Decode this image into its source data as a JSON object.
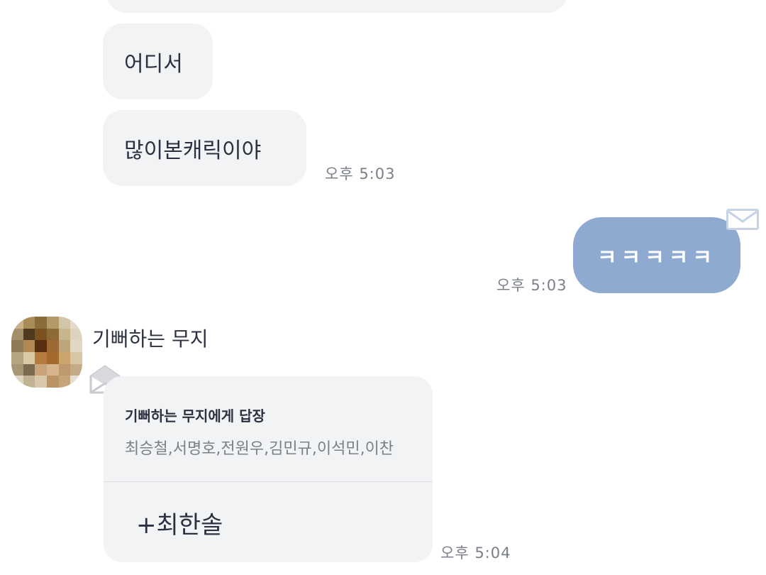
{
  "messages": {
    "top_partial": "",
    "m1": "어디서",
    "m2": "많이본캐릭이야",
    "m2_time": "오후 5:03",
    "m3": "ㅋㅋㅋㅋㅋ",
    "m3_time": "오후 5:03"
  },
  "sender": {
    "name": "기뻐하는 무지"
  },
  "reply": {
    "title": "기뻐하는 무지에게 답장",
    "quote": "최승철,서명호,전원우,김민규,이석민,이찬",
    "body": "+최한솔",
    "time": "오후 5:04"
  },
  "colors": {
    "incoming_bubble": "#f2f3f5",
    "outgoing_bubble": "#8faad1",
    "text": "#2b3140",
    "timestamp": "#7a7f8a"
  },
  "icons": {
    "envelope_out": "envelope-icon",
    "envelope_in": "open-envelope-icon"
  }
}
